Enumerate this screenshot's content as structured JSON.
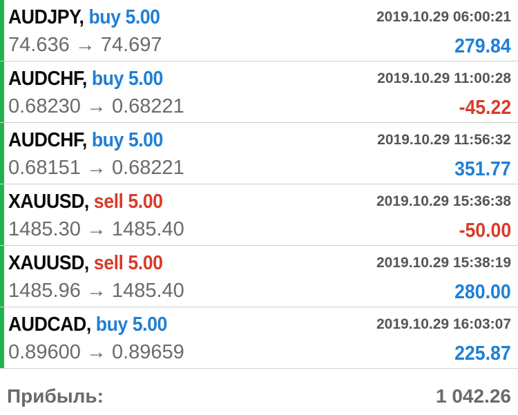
{
  "colors": {
    "buy": "#1f7fd6",
    "sell": "#d93b2b",
    "profit_positive": "#1f7fd6",
    "profit_negative": "#d93b2b",
    "side_bar": "#22b24c"
  },
  "trades": [
    {
      "symbol": "AUDJPY,",
      "direction": "buy",
      "volume_label": "buy 5.00",
      "time": "2019.10.29 06:00:21",
      "prices": "74.636 → 74.697",
      "profit": "279.84",
      "profit_sign": "pos"
    },
    {
      "symbol": "AUDCHF,",
      "direction": "buy",
      "volume_label": "buy 5.00",
      "time": "2019.10.29 11:00:28",
      "prices": "0.68230 → 0.68221",
      "profit": "-45.22",
      "profit_sign": "neg"
    },
    {
      "symbol": "AUDCHF,",
      "direction": "buy",
      "volume_label": "buy 5.00",
      "time": "2019.10.29 11:56:32",
      "prices": "0.68151 → 0.68221",
      "profit": "351.77",
      "profit_sign": "pos"
    },
    {
      "symbol": "XAUUSD,",
      "direction": "sell",
      "volume_label": "sell 5.00",
      "time": "2019.10.29 15:36:38",
      "prices": "1485.30 → 1485.40",
      "profit": "-50.00",
      "profit_sign": "neg"
    },
    {
      "symbol": "XAUUSD,",
      "direction": "sell",
      "volume_label": "sell 5.00",
      "time": "2019.10.29 15:38:19",
      "prices": "1485.96 → 1485.40",
      "profit": "280.00",
      "profit_sign": "pos"
    },
    {
      "symbol": "AUDCAD,",
      "direction": "buy",
      "volume_label": "buy 5.00",
      "time": "2019.10.29 16:03:07",
      "prices": "0.89600 → 0.89659",
      "profit": "225.87",
      "profit_sign": "pos"
    }
  ],
  "footer": {
    "label": "Прибыль:",
    "total": "1 042.26"
  }
}
